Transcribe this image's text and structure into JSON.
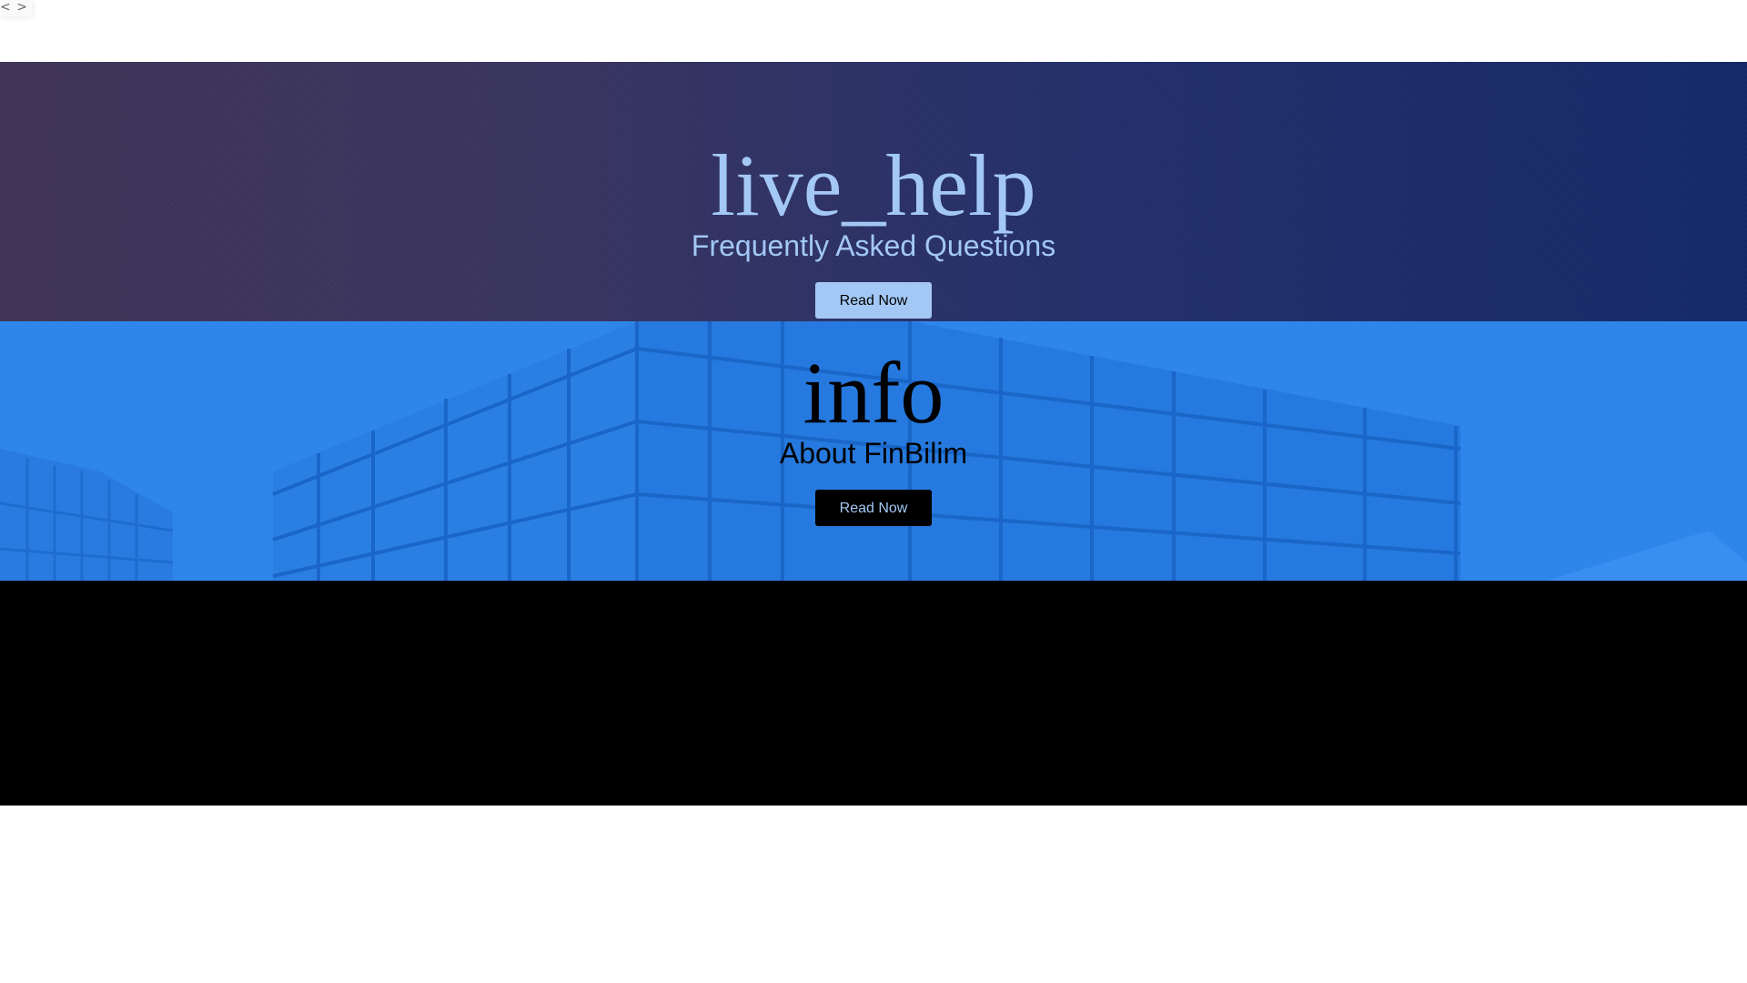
{
  "nav": {
    "back_icon": "chevron-left-icon",
    "forward_icon": "chevron-right-icon",
    "back_glyph": "<",
    "forward_glyph": ">"
  },
  "faq": {
    "icon_text": "live_help",
    "title": "Frequently Asked Questions",
    "button_label": "Read Now"
  },
  "about": {
    "icon_text": "info",
    "title": "About FinBilim",
    "button_label": "Read Now"
  },
  "colors": {
    "faq_bg": "#3a3560",
    "about_bg": "#2e86ea",
    "accent_light": "#a3c8f5",
    "footer_bg": "#000000"
  }
}
